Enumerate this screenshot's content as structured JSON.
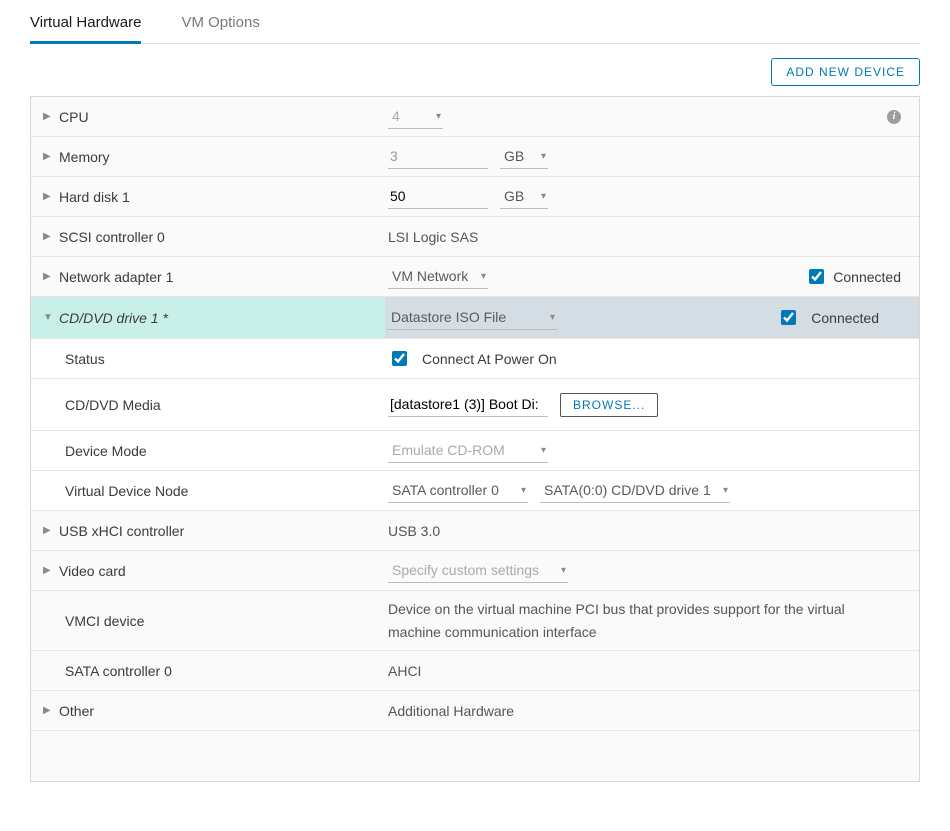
{
  "tabs": {
    "vh": "Virtual Hardware",
    "vmopt": "VM Options"
  },
  "buttons": {
    "add_new_device": "ADD NEW DEVICE",
    "browse": "BROWSE..."
  },
  "rows": {
    "cpu": {
      "label": "CPU",
      "value": "4"
    },
    "memory": {
      "label": "Memory",
      "value": "3",
      "unit": "GB"
    },
    "hdd1": {
      "label": "Hard disk 1",
      "value": "50",
      "unit": "GB"
    },
    "scsi0": {
      "label": "SCSI controller 0",
      "value": "LSI Logic SAS"
    },
    "net1": {
      "label": "Network adapter 1",
      "value": "VM Network",
      "connected": "Connected"
    },
    "cd1": {
      "label": "CD/DVD drive 1 *",
      "value": "Datastore ISO File",
      "connected": "Connected"
    },
    "status": {
      "label": "Status",
      "value": "Connect At Power On"
    },
    "media": {
      "label": "CD/DVD Media",
      "value": "[datastore1 (3)] Boot Di:"
    },
    "devmode": {
      "label": "Device Mode",
      "value": "Emulate CD-ROM"
    },
    "vdn": {
      "label": "Virtual Device Node",
      "ctrl": "SATA controller 0",
      "node": "SATA(0:0) CD/DVD drive 1"
    },
    "usb": {
      "label": "USB xHCI controller",
      "value": "USB 3.0"
    },
    "video": {
      "label": "Video card",
      "value": "Specify custom settings"
    },
    "vmci": {
      "label": "VMCI device",
      "value": "Device on the virtual machine PCI bus that provides support for the virtual machine communication interface"
    },
    "sata0": {
      "label": "SATA controller 0",
      "value": "AHCI"
    },
    "other": {
      "label": "Other",
      "value": "Additional Hardware"
    }
  }
}
